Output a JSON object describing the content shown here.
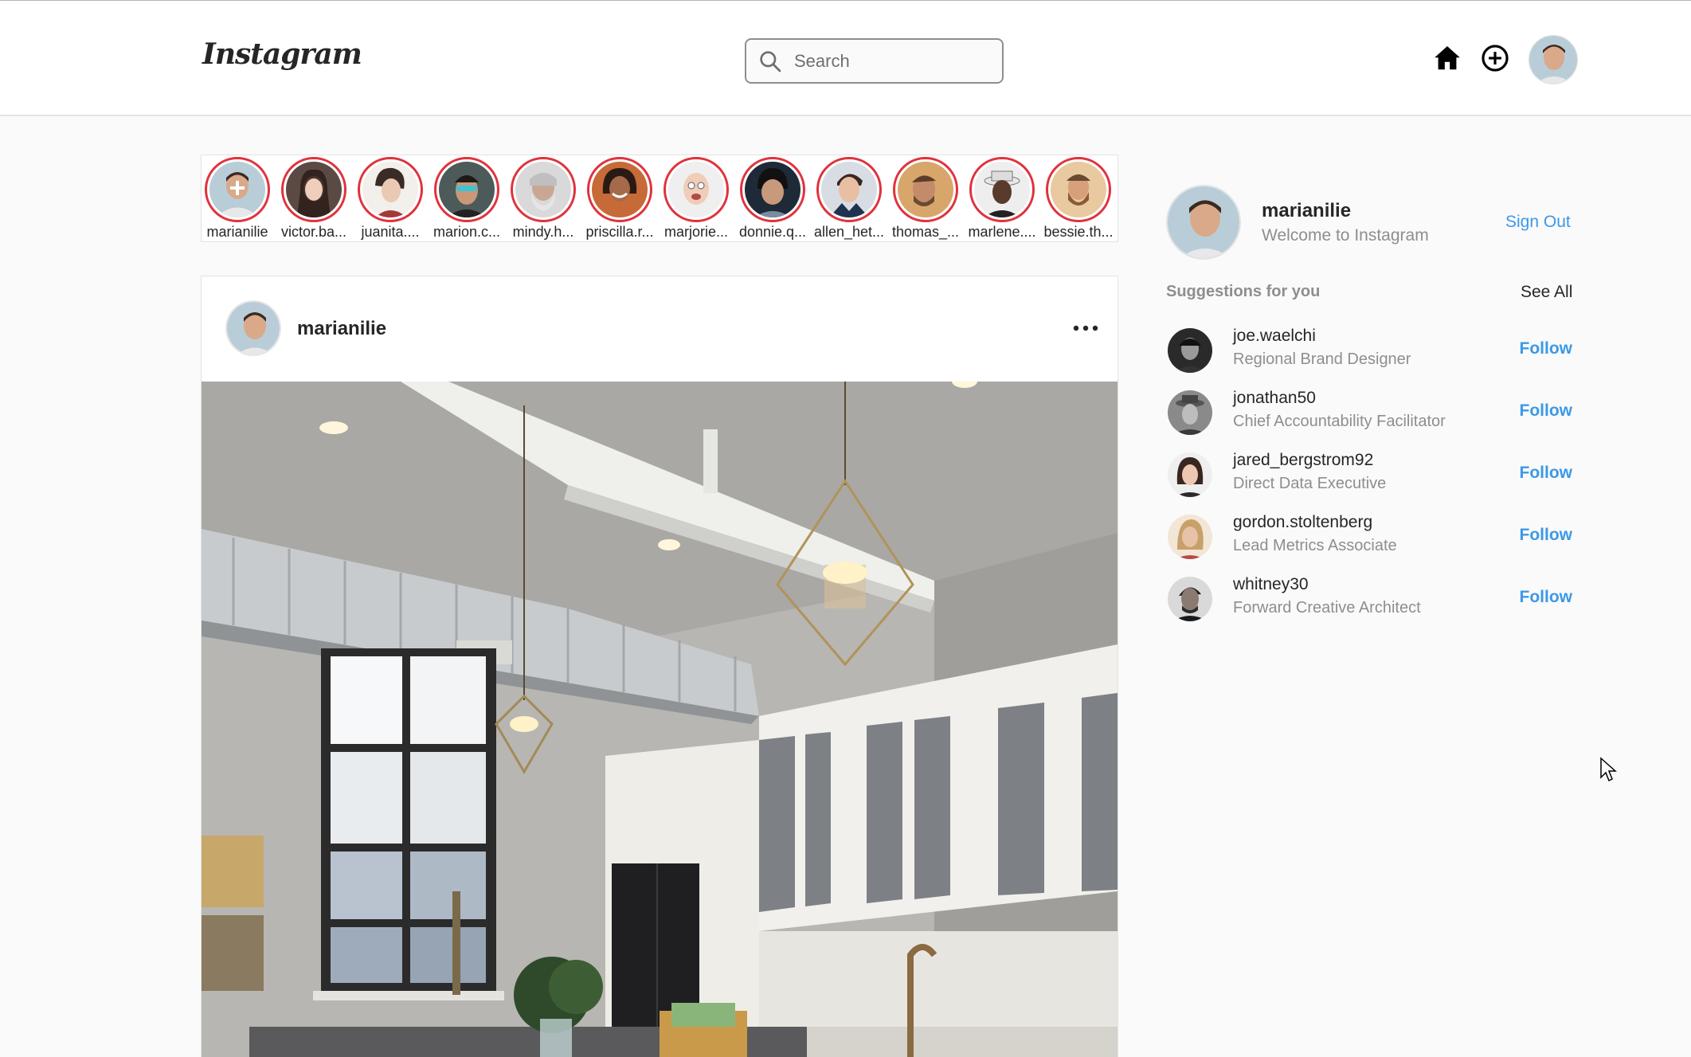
{
  "header": {
    "logo_text": "Instagram",
    "search": {
      "placeholder": "Search",
      "value": ""
    },
    "icons": [
      "home-icon",
      "add-post-icon",
      "profile-avatar"
    ]
  },
  "stories": [
    {
      "name": "marianilie"
    },
    {
      "name": "victor.ba..."
    },
    {
      "name": "juanita...."
    },
    {
      "name": "marion.c..."
    },
    {
      "name": "mindy.h..."
    },
    {
      "name": "priscilla.r..."
    },
    {
      "name": "marjorie..."
    },
    {
      "name": "donnie.q..."
    },
    {
      "name": "allen_het..."
    },
    {
      "name": "thomas_..."
    },
    {
      "name": "marlene...."
    },
    {
      "name": "bessie.th..."
    }
  ],
  "post": {
    "username": "marianilie",
    "more_icon": "more-horizontal-icon",
    "image_subject": "kitchen-interior-photo"
  },
  "sidebar": {
    "username": "marianilie",
    "subtitle": "Welcome to Instagram",
    "signout_label": "Sign Out",
    "suggestions_title": "Suggestions for you",
    "see_all_label": "See All",
    "suggestions": [
      {
        "username": "joe.waelchi",
        "role": "Regional Brand Designer",
        "action": "Follow"
      },
      {
        "username": "jonathan50",
        "role": "Chief Accountability Facilitator",
        "action": "Follow"
      },
      {
        "username": "jared_bergstrom92",
        "role": "Direct Data Executive",
        "action": "Follow"
      },
      {
        "username": "gordon.stoltenberg",
        "role": "Lead Metrics Associate",
        "action": "Follow"
      },
      {
        "username": "whitney30",
        "role": "Forward Creative Architect",
        "action": "Follow"
      }
    ]
  },
  "colors": {
    "accent_blue": "#3c98e8",
    "story_ring": "#e0323c",
    "background": "#fafafa",
    "muted_text": "#8e8e8e"
  }
}
